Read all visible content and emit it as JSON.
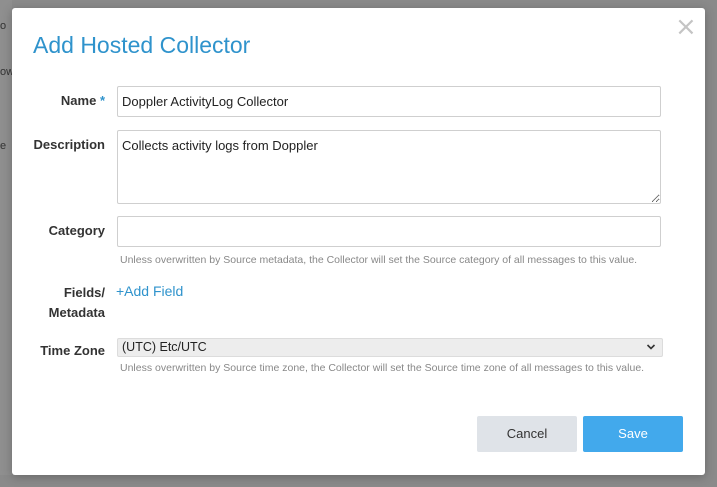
{
  "backdrop": {
    "fragments": [
      "o",
      "ow",
      "e"
    ]
  },
  "modal": {
    "title": "Add Hosted Collector",
    "close_symbol": "×"
  },
  "form": {
    "name": {
      "label": "Name",
      "required_marker": "*",
      "value": "Doppler ActivityLog Collector"
    },
    "description": {
      "label": "Description",
      "value": "Collects activity logs from Doppler"
    },
    "category": {
      "label": "Category",
      "value": "",
      "help": "Unless overwritten by Source metadata, the Collector will set the Source category of all messages to this value."
    },
    "fields": {
      "label_line1": "Fields/",
      "label_line2": "Metadata",
      "add_label": "+Add Field"
    },
    "time_zone": {
      "label": "Time Zone",
      "selected": "(UTC) Etc/UTC",
      "chevron_icon": "chevron-down-icon",
      "help": "Unless overwritten by Source time zone, the Collector will set the Source time zone of all messages to this value."
    }
  },
  "actions": {
    "cancel_label": "Cancel",
    "save_label": "Save"
  },
  "colors": {
    "accent": "#2f93cc",
    "save_button": "#42a9ec",
    "cancel_button": "#dfe3e8"
  }
}
